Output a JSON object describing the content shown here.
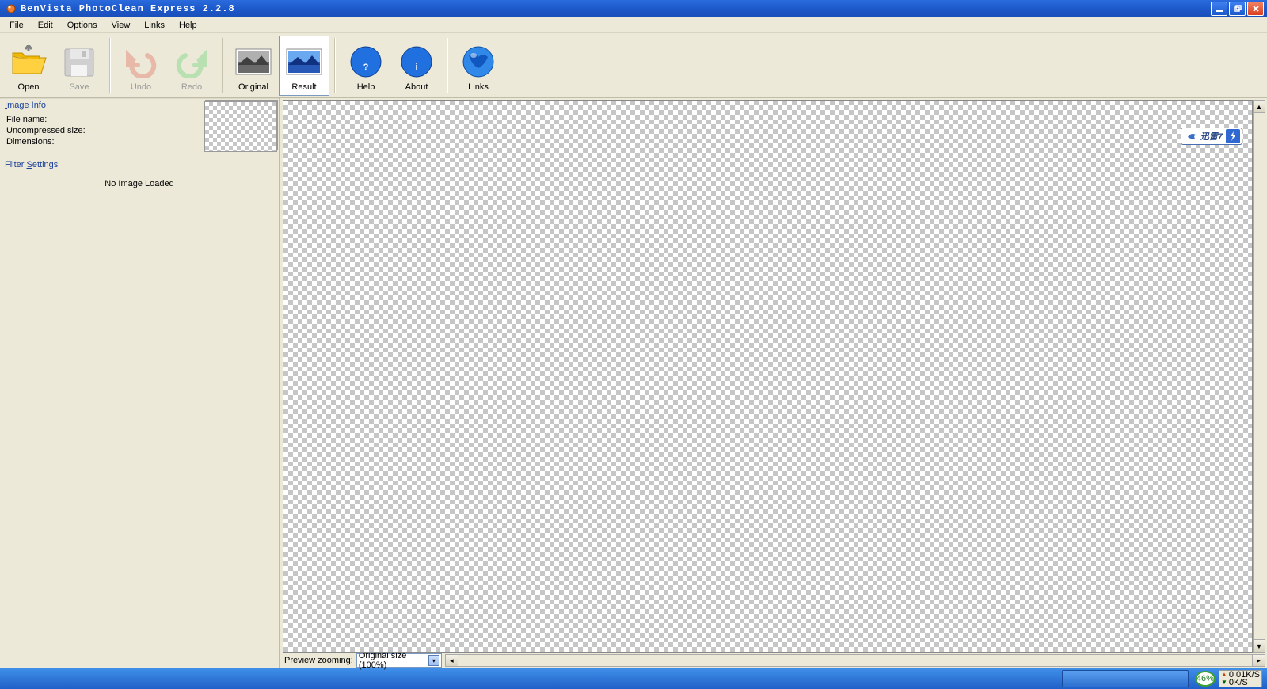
{
  "app": {
    "title": "BenVista PhotoClean Express 2.2.8"
  },
  "menu": {
    "file": "File",
    "edit": "Edit",
    "options": "Options",
    "view": "View",
    "links": "Links",
    "help": "Help"
  },
  "toolbar": {
    "open": "Open",
    "save": "Save",
    "undo": "Undo",
    "redo": "Redo",
    "original": "Original",
    "result": "Result",
    "help": "Help",
    "about": "About",
    "links": "Links"
  },
  "sidebar": {
    "image_info_title": "Image Info",
    "filename_label": "File name:",
    "uncompressed_label": "Uncompressed size:",
    "dimensions_label": "Dimensions:",
    "filter_title": "Filter Settings",
    "no_image": "No Image Loaded"
  },
  "zoom": {
    "label": "Preview zooming:",
    "value": "Original size (100%)"
  },
  "overlay": {
    "badge": "迅雷7"
  },
  "tray": {
    "cpu": "46%",
    "up": "0.01K/S",
    "down": "0K/S"
  }
}
